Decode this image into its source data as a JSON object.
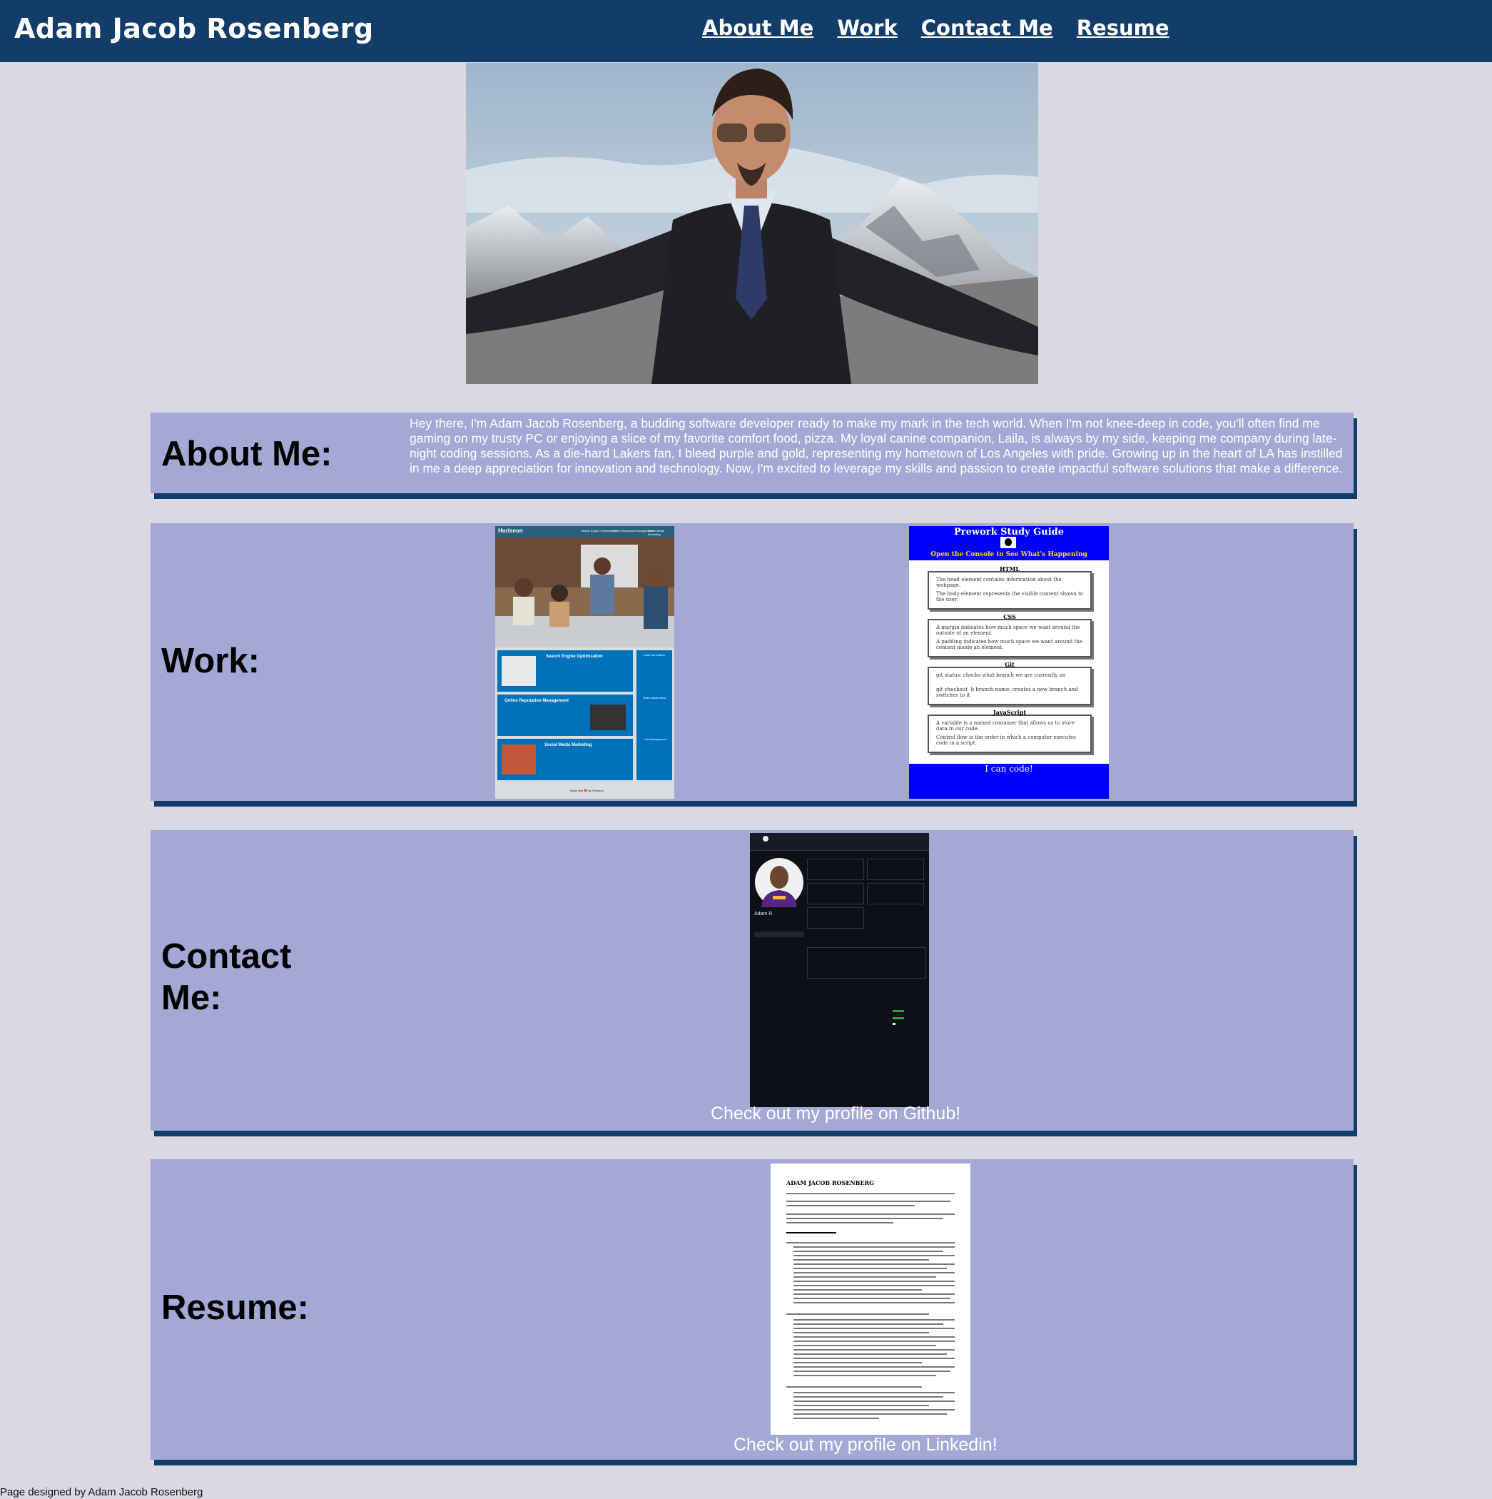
{
  "header": {
    "site_title": "Adam Jacob Rosenberg",
    "nav": [
      {
        "label": "About Me"
      },
      {
        "label": "Work"
      },
      {
        "label": "Contact Me"
      },
      {
        "label": "Resume"
      }
    ]
  },
  "about": {
    "heading": "About Me:",
    "text": "Hey there, I'm Adam Jacob Rosenberg, a budding software developer ready to make my mark in the tech world. When I'm not knee-deep in code, you'll often find me gaming on my trusty PC or enjoying a slice of my favorite comfort food, pizza. My loyal canine companion, Laila, is always by my side, keeping me company during late-night coding sessions. As a die-hard Lakers fan, I bleed purple and gold, representing my hometown of Los Angeles with pride. Growing up in the heart of LA has instilled in me a deep appreciation for innovation and technology. Now, I'm excited to leverage my skills and passion to create impactful software solutions that make a difference."
  },
  "work": {
    "heading": "Work:",
    "horiseon": {
      "brand": "Horiseon",
      "nav": [
        "Search Engine Optimization",
        "Online Reputation Management",
        "Social Media Marketing"
      ],
      "cards": [
        "Search Engine Optimization",
        "Online Reputation Management",
        "Social Media Marketing"
      ],
      "side": [
        "Lead Generation",
        "Brand Awareness",
        "Cost Management"
      ],
      "footer": "Made with ❤️ by Horiseon"
    },
    "prework": {
      "title": "Prework Study Guide",
      "subtitle": "Open the Console to See What's Happening",
      "topics": [
        {
          "name": "HTML",
          "items": [
            "The head element contains information about the webpage.",
            "The body element represents the visible content shown to the user."
          ]
        },
        {
          "name": "CSS",
          "items": [
            "A margin indicates how much space we want around the outside of an element.",
            "A padding indicates how much space we want around the content inside an element."
          ]
        },
        {
          "name": "Git",
          "items": [
            "git status: checks what branch we are currently on",
            "git checkout -b branch-name: creates a new branch and switches to it"
          ]
        },
        {
          "name": "JavaScript",
          "items": [
            "A variable is a named container that allows us to store data in our code.",
            "Control flow is the order in which a computer executes code in a script."
          ]
        }
      ],
      "footer": "I can code!"
    }
  },
  "contact": {
    "heading": "Contact Me:",
    "profile_name": "Adam R.",
    "caption": "Check out my profile on Github!"
  },
  "resume": {
    "heading": "Resume:",
    "name": "ADAM JACOB ROSENBERG",
    "caption": "Check out my profile on Linkedin!"
  },
  "footer": {
    "text": "Page designed by Adam Jacob Rosenberg"
  },
  "colors": {
    "header_bg": "#133d69",
    "page_bg": "#d9d8e3",
    "section_bg": "#a3a8d5",
    "section_shadow": "#133d69",
    "prework_blue": "#0000ff",
    "horiseon_blue": "#0072bb"
  }
}
